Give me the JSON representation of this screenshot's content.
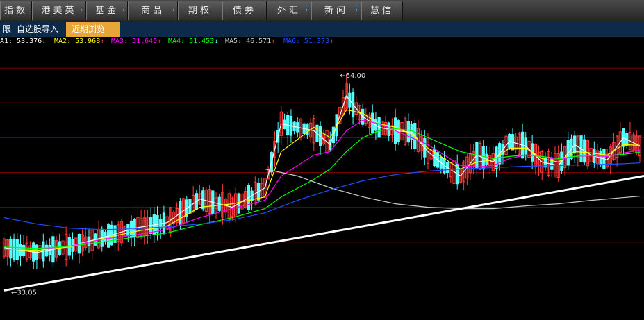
{
  "nav": {
    "tabs": [
      {
        "label": "指数",
        "more": false
      },
      {
        "label": "港美英",
        "more": true
      },
      {
        "label": "基金",
        "more": true
      },
      {
        "label": "商品",
        "more": true
      },
      {
        "label": "期权",
        "more": false
      },
      {
        "label": "债券",
        "more": false
      },
      {
        "label": "外汇",
        "more": true
      },
      {
        "label": "新闻",
        "more": true
      },
      {
        "label": "慧信",
        "more": false
      }
    ],
    "more_glyph": "⁝"
  },
  "subnav": {
    "partial": "限",
    "import": "自选股导入",
    "recent": "近期浏览"
  },
  "ma_legend": [
    {
      "label": "A1:",
      "value": "53.376",
      "arrow": "↓",
      "color": "#ffffff"
    },
    {
      "label": "MA2:",
      "value": "53.968",
      "arrow": "↑",
      "color": "#ffff00"
    },
    {
      "label": "MA3:",
      "value": "51.645",
      "arrow": "↑",
      "color": "#ff00ff"
    },
    {
      "label": "MA4:",
      "value": "51.453",
      "arrow": "↓",
      "color": "#00ff00"
    },
    {
      "label": "MA5:",
      "value": "46.571",
      "arrow": "↑",
      "color": "#c8c8c8"
    },
    {
      "label": "MA6:",
      "value": "51.373",
      "arrow": "↑",
      "color": "#1e50ff"
    }
  ],
  "colors": {
    "up": "#ff3c3c",
    "down": "#54ffff",
    "grid": "#7a0000",
    "trendline": "#ffffff",
    "ma1": "#ffffff",
    "ma2": "#ffff00",
    "ma3": "#ff00ff",
    "ma4": "#00ff00",
    "ma5": "#c8c8c8",
    "ma6": "#1e50ff"
  },
  "chart_data": {
    "type": "candlestick",
    "ylim": [
      30,
      68
    ],
    "high_label": "64.00",
    "low_label": "33.05",
    "high": 64.0,
    "low": 33.05,
    "gridlines": [
      40,
      45,
      50,
      55,
      60,
      65
    ],
    "trendline": {
      "start": [
        0,
        33.05
      ],
      "end": [
        195,
        49.5
      ]
    },
    "series": [
      {
        "name": "MA1",
        "color": "#ffffff",
        "points": [
          [
            0,
            39.2
          ],
          [
            10,
            38.5
          ],
          [
            20,
            39.4
          ],
          [
            30,
            40.6
          ],
          [
            40,
            42.0
          ],
          [
            50,
            42.8
          ],
          [
            60,
            46.2
          ],
          [
            70,
            45.0
          ],
          [
            80,
            47.8
          ],
          [
            85,
            57.0
          ],
          [
            95,
            56.0
          ],
          [
            100,
            54.0
          ],
          [
            105,
            61.0
          ],
          [
            110,
            58.0
          ],
          [
            115,
            56.5
          ],
          [
            120,
            56.0
          ],
          [
            125,
            55.8
          ],
          [
            130,
            53.0
          ],
          [
            135,
            51.0
          ],
          [
            140,
            49.5
          ],
          [
            145,
            52.5
          ],
          [
            150,
            51.5
          ],
          [
            155,
            54.5
          ],
          [
            160,
            53.8
          ],
          [
            165,
            51.5
          ],
          [
            170,
            51.0
          ],
          [
            175,
            54.0
          ],
          [
            180,
            52.5
          ],
          [
            185,
            51.8
          ],
          [
            190,
            55.0
          ],
          [
            195,
            53.8
          ]
        ]
      },
      {
        "name": "MA2",
        "color": "#ffff00",
        "points": [
          [
            0,
            39.0
          ],
          [
            10,
            38.8
          ],
          [
            20,
            39.3
          ],
          [
            30,
            40.5
          ],
          [
            40,
            41.5
          ],
          [
            50,
            42.3
          ],
          [
            60,
            45.0
          ],
          [
            70,
            45.5
          ],
          [
            80,
            46.5
          ],
          [
            85,
            53.0
          ],
          [
            95,
            56.5
          ],
          [
            100,
            55.0
          ],
          [
            105,
            59.0
          ],
          [
            110,
            58.5
          ],
          [
            115,
            57.0
          ],
          [
            120,
            56.5
          ],
          [
            125,
            55.5
          ],
          [
            130,
            53.5
          ],
          [
            135,
            52.0
          ],
          [
            140,
            50.5
          ],
          [
            145,
            51.5
          ],
          [
            150,
            51.8
          ],
          [
            155,
            53.5
          ],
          [
            160,
            53.5
          ],
          [
            165,
            52.0
          ],
          [
            170,
            51.5
          ],
          [
            175,
            53.0
          ],
          [
            180,
            52.8
          ],
          [
            185,
            52.5
          ],
          [
            190,
            54.0
          ],
          [
            195,
            53.9
          ]
        ]
      },
      {
        "name": "MA3",
        "color": "#ff00ff",
        "points": [
          [
            0,
            39.0
          ],
          [
            10,
            39.0
          ],
          [
            20,
            39.4
          ],
          [
            30,
            40.4
          ],
          [
            40,
            41.0
          ],
          [
            50,
            41.8
          ],
          [
            60,
            43.5
          ],
          [
            70,
            44.8
          ],
          [
            80,
            46.0
          ],
          [
            85,
            49.5
          ],
          [
            95,
            52.5
          ],
          [
            100,
            53.0
          ],
          [
            105,
            56.0
          ],
          [
            110,
            57.5
          ],
          [
            115,
            57.0
          ],
          [
            120,
            56.0
          ],
          [
            125,
            55.0
          ],
          [
            130,
            54.0
          ],
          [
            135,
            52.5
          ],
          [
            140,
            51.0
          ],
          [
            145,
            50.8
          ],
          [
            150,
            51.0
          ],
          [
            155,
            52.0
          ],
          [
            160,
            52.5
          ],
          [
            165,
            52.3
          ],
          [
            170,
            51.8
          ],
          [
            175,
            52.3
          ],
          [
            180,
            52.4
          ],
          [
            185,
            52.3
          ],
          [
            190,
            52.8
          ],
          [
            195,
            53.2
          ]
        ]
      },
      {
        "name": "MA4",
        "color": "#00ff00",
        "points": [
          [
            0,
            39.3
          ],
          [
            10,
            39.1
          ],
          [
            20,
            39.4
          ],
          [
            30,
            40.0
          ],
          [
            40,
            40.7
          ],
          [
            50,
            41.3
          ],
          [
            60,
            42.5
          ],
          [
            70,
            43.5
          ],
          [
            80,
            44.8
          ],
          [
            85,
            46.5
          ],
          [
            95,
            49.0
          ],
          [
            100,
            50.5
          ],
          [
            105,
            53.0
          ],
          [
            110,
            55.0
          ],
          [
            115,
            56.0
          ],
          [
            120,
            56.3
          ],
          [
            125,
            56.0
          ],
          [
            130,
            55.0
          ],
          [
            135,
            54.0
          ],
          [
            140,
            53.0
          ],
          [
            145,
            52.5
          ],
          [
            150,
            52.0
          ],
          [
            155,
            52.3
          ],
          [
            160,
            52.5
          ],
          [
            165,
            52.3
          ],
          [
            170,
            52.0
          ],
          [
            175,
            52.3
          ],
          [
            180,
            52.5
          ],
          [
            185,
            52.4
          ],
          [
            190,
            52.6
          ],
          [
            195,
            52.9
          ]
        ]
      },
      {
        "name": "MA5",
        "color": "#c8c8c8",
        "points": [
          [
            80,
            50.5
          ],
          [
            90,
            49.5
          ],
          [
            100,
            47.8
          ],
          [
            110,
            46.5
          ],
          [
            120,
            45.5
          ],
          [
            130,
            45.0
          ],
          [
            140,
            44.8
          ],
          [
            150,
            44.8
          ],
          [
            160,
            45.2
          ],
          [
            170,
            45.5
          ],
          [
            180,
            46.0
          ],
          [
            195,
            46.6
          ]
        ]
      },
      {
        "name": "MA6",
        "color": "#1e50ff",
        "points": [
          [
            0,
            43.5
          ],
          [
            10,
            42.6
          ],
          [
            20,
            42.0
          ],
          [
            30,
            41.8
          ],
          [
            40,
            41.9
          ],
          [
            50,
            42.2
          ],
          [
            60,
            42.6
          ],
          [
            70,
            43.2
          ],
          [
            80,
            44.2
          ],
          [
            90,
            46.0
          ],
          [
            100,
            47.5
          ],
          [
            110,
            48.8
          ],
          [
            120,
            49.7
          ],
          [
            130,
            50.2
          ],
          [
            140,
            50.5
          ],
          [
            150,
            50.7
          ],
          [
            160,
            50.9
          ],
          [
            170,
            51.0
          ],
          [
            180,
            51.1
          ],
          [
            190,
            51.25
          ],
          [
            195,
            51.37
          ]
        ]
      }
    ]
  }
}
